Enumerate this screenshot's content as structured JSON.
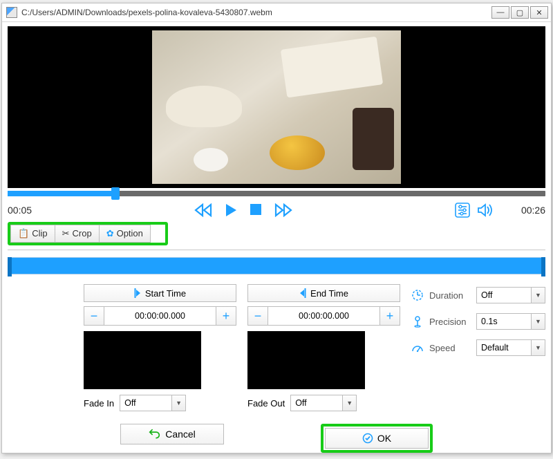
{
  "window": {
    "title": "C:/Users/ADMIN/Downloads/pexels-polina-kovaleva-5430807.webm"
  },
  "time": {
    "current": "00:05",
    "total": "00:26"
  },
  "tabs": {
    "clip": "Clip",
    "crop": "Crop",
    "option": "Option"
  },
  "clip": {
    "start_label": "Start Time",
    "start_value": "00:00:00.000",
    "end_label": "End Time",
    "end_value": "00:00:00.000",
    "fade_in_label": "Fade In",
    "fade_in_value": "Off",
    "fade_out_label": "Fade Out",
    "fade_out_value": "Off"
  },
  "props": {
    "duration_label": "Duration",
    "duration_value": "Off",
    "precision_label": "Precision",
    "precision_value": "0.1s",
    "speed_label": "Speed",
    "speed_value": "Default"
  },
  "buttons": {
    "cancel": "Cancel",
    "ok": "OK",
    "minus": "−",
    "plus": "+"
  },
  "seek": {
    "progress_percent": 20
  }
}
